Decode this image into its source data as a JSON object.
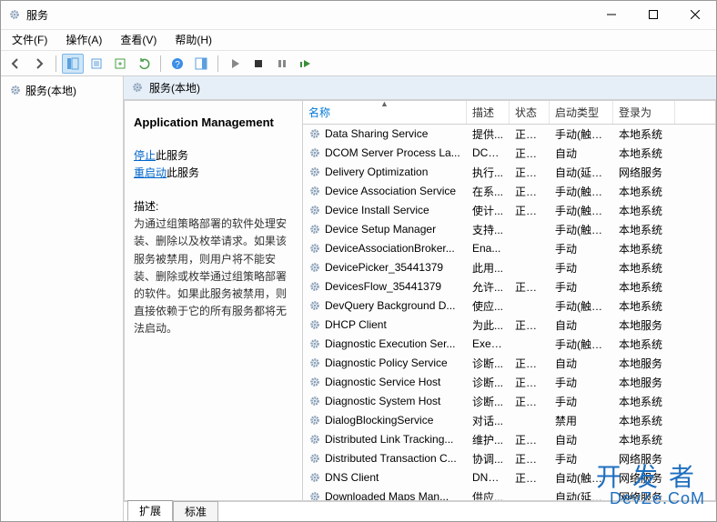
{
  "window": {
    "title": "服务"
  },
  "menu": {
    "file": "文件(F)",
    "action": "操作(A)",
    "view": "查看(V)",
    "help": "帮助(H)"
  },
  "nav": {
    "root": "服务(本地)"
  },
  "main": {
    "header": "服务(本地)"
  },
  "detail": {
    "title": "Application Management",
    "stop_link": "停止",
    "stop_suffix": "此服务",
    "restart_link": "重启动",
    "restart_suffix": "此服务",
    "desc_label": "描述:",
    "desc_text": "为通过组策略部署的软件处理安装、删除以及枚举请求。如果该服务被禁用，则用户将不能安装、删除或枚举通过组策略部署的软件。如果此服务被禁用，则直接依赖于它的所有服务都将无法启动。"
  },
  "columns": {
    "name": "名称",
    "desc": "描述",
    "state": "状态",
    "start": "启动类型",
    "logon": "登录为"
  },
  "services": [
    {
      "name": "Data Sharing Service",
      "desc": "提供...",
      "state": "正在...",
      "start": "手动(触发...",
      "logon": "本地系统"
    },
    {
      "name": "DCOM Server Process La...",
      "desc": "DCO...",
      "state": "正在...",
      "start": "自动",
      "logon": "本地系统"
    },
    {
      "name": "Delivery Optimization",
      "desc": "执行...",
      "state": "正在...",
      "start": "自动(延迟...",
      "logon": "网络服务"
    },
    {
      "name": "Device Association Service",
      "desc": "在系...",
      "state": "正在...",
      "start": "手动(触发...",
      "logon": "本地系统"
    },
    {
      "name": "Device Install Service",
      "desc": "使计...",
      "state": "正在...",
      "start": "手动(触发...",
      "logon": "本地系统"
    },
    {
      "name": "Device Setup Manager",
      "desc": "支持...",
      "state": "",
      "start": "手动(触发...",
      "logon": "本地系统"
    },
    {
      "name": "DeviceAssociationBroker...",
      "desc": "Ena...",
      "state": "",
      "start": "手动",
      "logon": "本地系统"
    },
    {
      "name": "DevicePicker_35441379",
      "desc": "此用...",
      "state": "",
      "start": "手动",
      "logon": "本地系统"
    },
    {
      "name": "DevicesFlow_35441379",
      "desc": "允许...",
      "state": "正在...",
      "start": "手动",
      "logon": "本地系统"
    },
    {
      "name": "DevQuery Background D...",
      "desc": "使应...",
      "state": "",
      "start": "手动(触发...",
      "logon": "本地系统"
    },
    {
      "name": "DHCP Client",
      "desc": "为此...",
      "state": "正在...",
      "start": "自动",
      "logon": "本地服务"
    },
    {
      "name": "Diagnostic Execution Ser...",
      "desc": "Exec...",
      "state": "",
      "start": "手动(触发...",
      "logon": "本地系统"
    },
    {
      "name": "Diagnostic Policy Service",
      "desc": "诊断...",
      "state": "正在...",
      "start": "自动",
      "logon": "本地服务"
    },
    {
      "name": "Diagnostic Service Host",
      "desc": "诊断...",
      "state": "正在...",
      "start": "手动",
      "logon": "本地服务"
    },
    {
      "name": "Diagnostic System Host",
      "desc": "诊断...",
      "state": "正在...",
      "start": "手动",
      "logon": "本地系统"
    },
    {
      "name": "DialogBlockingService",
      "desc": "对话...",
      "state": "",
      "start": "禁用",
      "logon": "本地系统"
    },
    {
      "name": "Distributed Link Tracking...",
      "desc": "维护...",
      "state": "正在...",
      "start": "自动",
      "logon": "本地系统"
    },
    {
      "name": "Distributed Transaction C...",
      "desc": "协调...",
      "state": "正在...",
      "start": "手动",
      "logon": "网络服务"
    },
    {
      "name": "DNS Client",
      "desc": "DNS...",
      "state": "正在...",
      "start": "自动(触发...",
      "logon": "网络服务"
    },
    {
      "name": "Downloaded Maps Man...",
      "desc": "供应...",
      "state": "",
      "start": "自动(延迟...",
      "logon": "网络服务"
    }
  ],
  "tabs": {
    "extended": "扩展",
    "standard": "标准"
  },
  "watermark": {
    "big": "开发者",
    "small": "DevZe.CoM"
  }
}
